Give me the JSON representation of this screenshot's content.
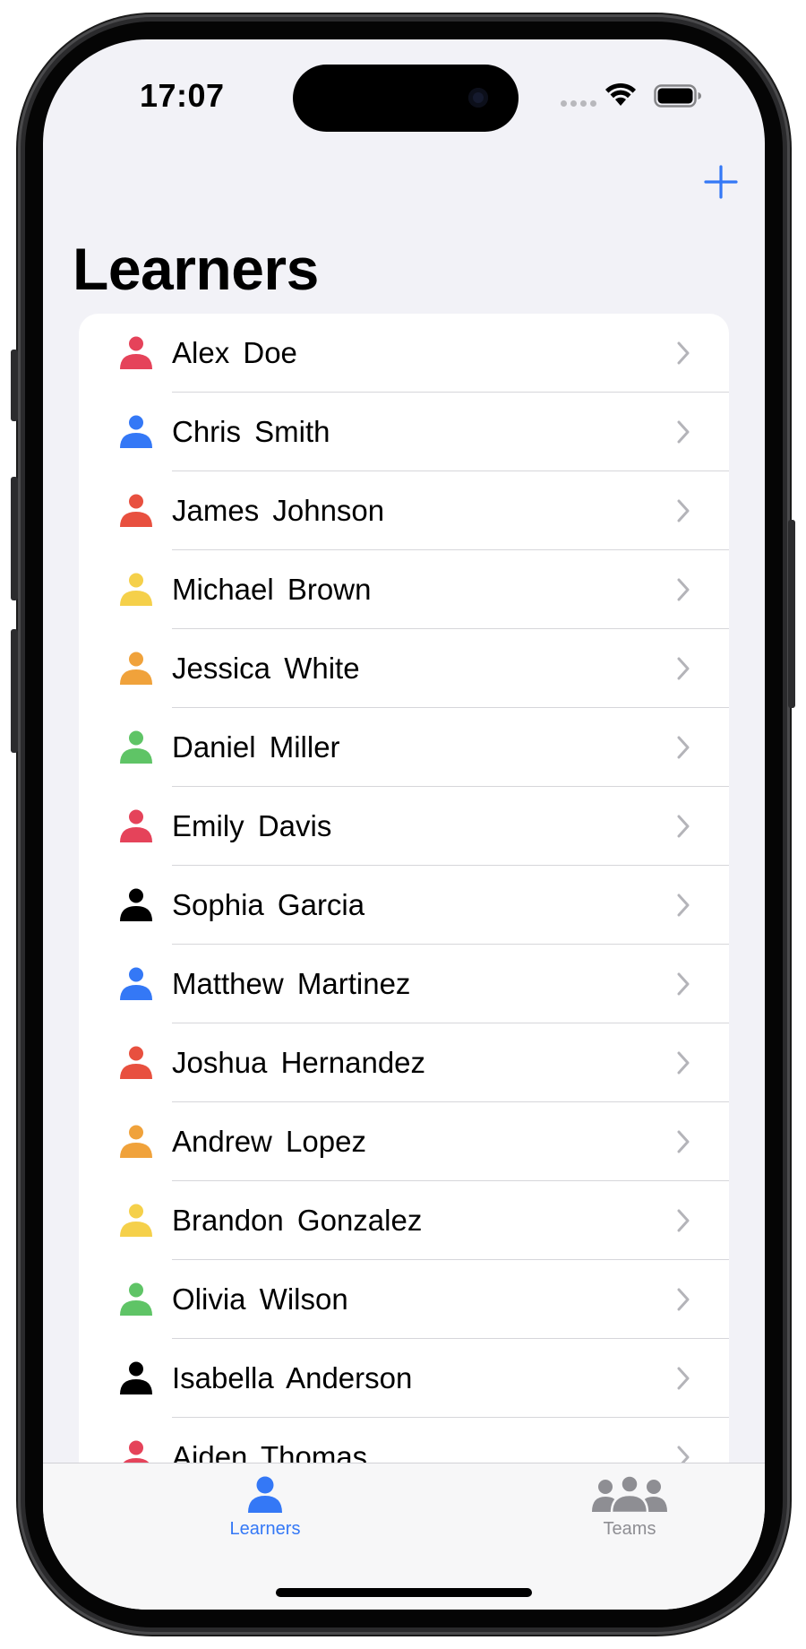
{
  "status_bar": {
    "time": "17:07"
  },
  "nav": {
    "title": "Learners",
    "add_icon": "plus-icon"
  },
  "colors": {
    "accent": "#3478f6",
    "red": "#e5435a",
    "blue": "#3478f6",
    "orange_red": "#e8503f",
    "yellow": "#f5d04a",
    "orange": "#f0a23b",
    "green": "#5fc466",
    "black": "#000000"
  },
  "learners": [
    {
      "name": "Alex  Doe",
      "color": "#e5435a"
    },
    {
      "name": "Chris  Smith",
      "color": "#3478f6"
    },
    {
      "name": "James  Johnson",
      "color": "#e8503f"
    },
    {
      "name": "Michael  Brown",
      "color": "#f5d04a"
    },
    {
      "name": "Jessica  White",
      "color": "#f0a23b"
    },
    {
      "name": "Daniel  Miller",
      "color": "#5fc466"
    },
    {
      "name": "Emily  Davis",
      "color": "#e5435a"
    },
    {
      "name": "Sophia  Garcia",
      "color": "#000000"
    },
    {
      "name": "Matthew  Martinez",
      "color": "#3478f6"
    },
    {
      "name": "Joshua  Hernandez",
      "color": "#e8503f"
    },
    {
      "name": "Andrew  Lopez",
      "color": "#f0a23b"
    },
    {
      "name": "Brandon  Gonzalez",
      "color": "#f5d04a"
    },
    {
      "name": "Olivia  Wilson",
      "color": "#5fc466"
    },
    {
      "name": "Isabella  Anderson",
      "color": "#000000"
    },
    {
      "name": "Aiden  Thomas",
      "color": "#e5435a"
    }
  ],
  "tab_bar": {
    "tabs": [
      {
        "label": "Learners",
        "icon": "person-icon",
        "selected": true
      },
      {
        "label": "Teams",
        "icon": "group-icon",
        "selected": false
      }
    ]
  }
}
